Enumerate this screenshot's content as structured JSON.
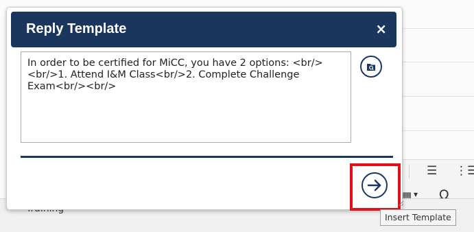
{
  "dialog": {
    "title": "Reply Template",
    "close_icon": "×",
    "template_text": "In order to be certified for MiCC, you have 2 options: <br/><br/>1. Attend I&M Class<br/>2. Complete Challenge Exam<br/><br/>",
    "search_icon": "search-icon",
    "insert_icon": "arrow-right-circle-icon",
    "tooltip": "Insert Template"
  },
  "background": {
    "section_label": "Training",
    "toolbar": {
      "bullet_list_icon": "☰",
      "numbered_list_icon": "⋮☰",
      "table_icon": "▦",
      "table_caret": "▾",
      "omega_icon": "Ω"
    }
  },
  "colors": {
    "header_bg": "#1b365d",
    "highlight_border": "#e0101a",
    "tooltip_bg": "#f5f5f5"
  }
}
